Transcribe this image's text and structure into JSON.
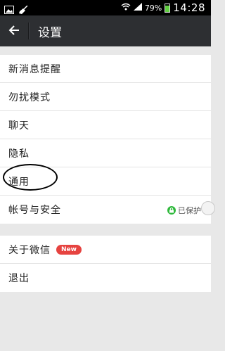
{
  "status_bar": {
    "battery_text": "79%",
    "time": "14:28",
    "icons": [
      "image-icon",
      "broom-icon",
      "wifi-icon",
      "signal-icon",
      "battery-icon"
    ]
  },
  "header": {
    "title": "设置",
    "back_icon": "back-arrow-icon",
    "bg_color": "#2d2f32"
  },
  "group1": {
    "items": [
      {
        "label": "新消息提醒"
      },
      {
        "label": "勿扰模式"
      },
      {
        "label": "聊天"
      },
      {
        "label": "隐私"
      },
      {
        "label": "通用"
      },
      {
        "label": "帐号与安全",
        "status": "已保护"
      }
    ]
  },
  "group2": {
    "items": [
      {
        "label": "关于微信",
        "badge": "New"
      },
      {
        "label": "退出"
      }
    ]
  },
  "colors": {
    "badge": "#e64340",
    "lock": "#2fb93c",
    "background": "#e8e8e8"
  }
}
